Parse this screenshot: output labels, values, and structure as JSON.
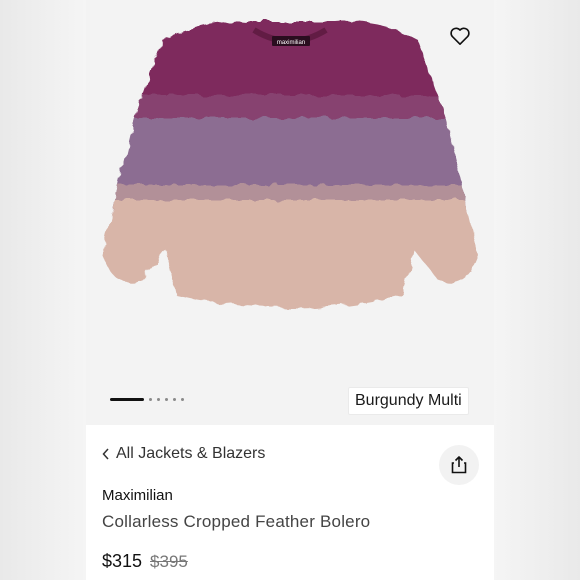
{
  "gallery": {
    "image_alt": "Collarless Cropped Feather Bolero",
    "image_label": "maximilian",
    "carousel_total": 6,
    "carousel_active_index": 1,
    "color_label": "Burgundy Multi",
    "wishlist_icon": "heart-icon"
  },
  "details": {
    "breadcrumb_label": "All Jackets & Blazers",
    "breadcrumb_icon": "chevron-left-icon",
    "share_icon": "share-icon",
    "brand": "Maximilian",
    "title": "Collarless Cropped Feather Bolero",
    "price_current": "$315",
    "price_original": "$395"
  },
  "colors": {
    "burgundy": "#7e2b5d",
    "mauve": "#8c6d92",
    "blush": "#d8b5a8"
  }
}
